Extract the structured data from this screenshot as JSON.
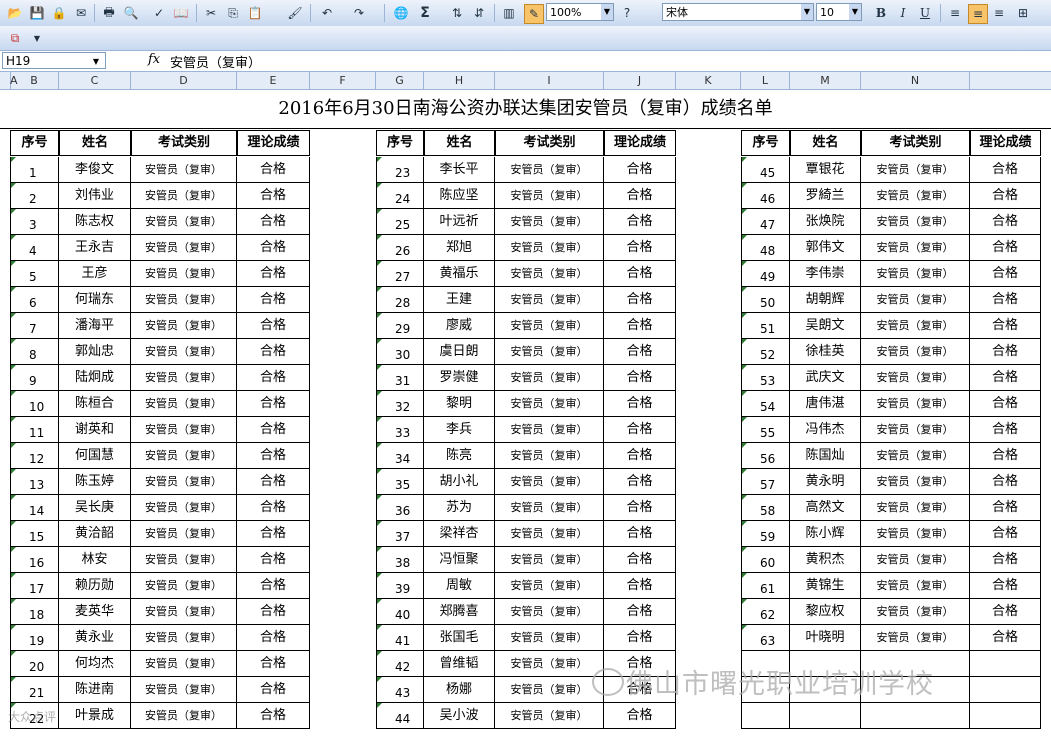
{
  "toolbar": {
    "zoom": "100%",
    "font_name": "宋体",
    "font_size": "10",
    "bold_label": "B",
    "italic_label": "I",
    "underline_label": "U",
    "sum_label": "Σ"
  },
  "formula_bar": {
    "name_box": "H19",
    "fx_label": "fx",
    "value": "安管员（复审）"
  },
  "columns": [
    "A",
    "B",
    "C",
    "D",
    "E",
    "F",
    "G",
    "H",
    "I",
    "J",
    "K",
    "L",
    "M",
    "N"
  ],
  "sheet": {
    "title": "2016年6月30日南海公资办联达集团安管员（复审）成绩名单",
    "headers": [
      "序号",
      "姓名",
      "考试类别",
      "理论成绩"
    ],
    "category": "安管员（复审）",
    "result": "合格",
    "group1": [
      {
        "no": "1",
        "name": "李俊文"
      },
      {
        "no": "2",
        "name": "刘伟业"
      },
      {
        "no": "3",
        "name": "陈志权"
      },
      {
        "no": "4",
        "name": "王永吉"
      },
      {
        "no": "5",
        "name": "王彦"
      },
      {
        "no": "6",
        "name": "何瑞东"
      },
      {
        "no": "7",
        "name": "潘海平"
      },
      {
        "no": "8",
        "name": "郭灿忠"
      },
      {
        "no": "9",
        "name": "陆炯成"
      },
      {
        "no": "10",
        "name": "陈桓合"
      },
      {
        "no": "11",
        "name": "谢英和"
      },
      {
        "no": "12",
        "name": "何国慧"
      },
      {
        "no": "13",
        "name": "陈玉婷"
      },
      {
        "no": "14",
        "name": "吴长庚"
      },
      {
        "no": "15",
        "name": "黄洽韶"
      },
      {
        "no": "16",
        "name": "林安"
      },
      {
        "no": "17",
        "name": "赖历勋"
      },
      {
        "no": "18",
        "name": "麦英华"
      },
      {
        "no": "19",
        "name": "黄永业"
      },
      {
        "no": "20",
        "name": "何均杰"
      },
      {
        "no": "21",
        "name": "陈进南"
      },
      {
        "no": "22",
        "name": "叶景成"
      }
    ],
    "group2": [
      {
        "no": "23",
        "name": "李长平"
      },
      {
        "no": "24",
        "name": "陈应坚"
      },
      {
        "no": "25",
        "name": "叶远祈"
      },
      {
        "no": "26",
        "name": "郑旭"
      },
      {
        "no": "27",
        "name": "黄福乐"
      },
      {
        "no": "28",
        "name": "王建"
      },
      {
        "no": "29",
        "name": "廖威"
      },
      {
        "no": "30",
        "name": "虞日朗"
      },
      {
        "no": "31",
        "name": "罗崇健"
      },
      {
        "no": "32",
        "name": "黎明"
      },
      {
        "no": "33",
        "name": "李兵"
      },
      {
        "no": "34",
        "name": "陈亮"
      },
      {
        "no": "35",
        "name": "胡小礼"
      },
      {
        "no": "36",
        "name": "苏为"
      },
      {
        "no": "37",
        "name": "梁祥杏"
      },
      {
        "no": "38",
        "name": "冯恒聚"
      },
      {
        "no": "39",
        "name": "周敏"
      },
      {
        "no": "40",
        "name": "郑腾喜"
      },
      {
        "no": "41",
        "name": "张国毛"
      },
      {
        "no": "42",
        "name": "曾维韬"
      },
      {
        "no": "43",
        "name": "杨娜"
      },
      {
        "no": "44",
        "name": "吴小波"
      }
    ],
    "group3": [
      {
        "no": "45",
        "name": "覃银花"
      },
      {
        "no": "46",
        "name": "罗綺兰"
      },
      {
        "no": "47",
        "name": "张焕院"
      },
      {
        "no": "48",
        "name": "郭伟文"
      },
      {
        "no": "49",
        "name": "李伟崇"
      },
      {
        "no": "50",
        "name": "胡朝辉"
      },
      {
        "no": "51",
        "name": "吴朗文"
      },
      {
        "no": "52",
        "name": "徐桂英"
      },
      {
        "no": "53",
        "name": "武庆文"
      },
      {
        "no": "54",
        "name": "唐伟湛"
      },
      {
        "no": "55",
        "name": "冯伟杰"
      },
      {
        "no": "56",
        "name": "陈国灿"
      },
      {
        "no": "57",
        "name": "黄永明"
      },
      {
        "no": "58",
        "name": "高然文"
      },
      {
        "no": "59",
        "name": "陈小辉"
      },
      {
        "no": "60",
        "name": "黄积杰"
      },
      {
        "no": "61",
        "name": "黄锦生"
      },
      {
        "no": "62",
        "name": "黎应权"
      },
      {
        "no": "63",
        "name": "叶晓明"
      }
    ]
  },
  "watermark": "佛山市曙光职业培训学校",
  "watermark2": "大众点评"
}
